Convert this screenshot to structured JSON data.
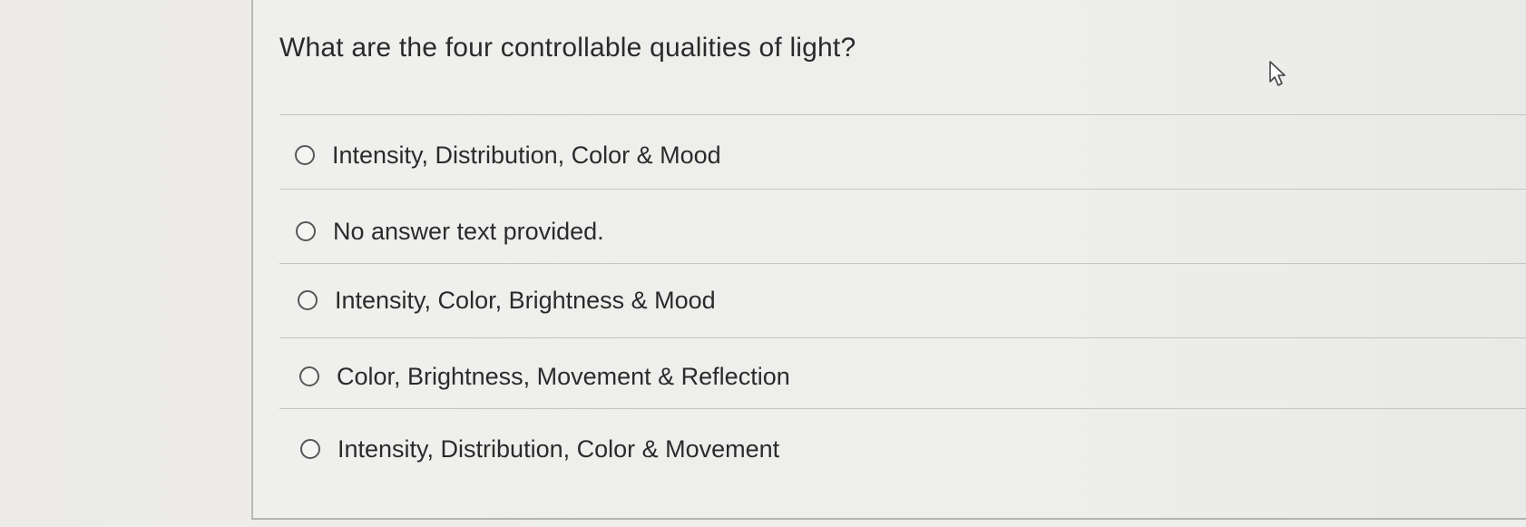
{
  "question": {
    "text": "What are the four controllable qualities of light?"
  },
  "options": [
    {
      "label": "Intensity, Distribution, Color & Mood"
    },
    {
      "label": "No answer text provided."
    },
    {
      "label": "Intensity, Color, Brightness & Mood"
    },
    {
      "label": "Color, Brightness, Movement & Reflection"
    },
    {
      "label": "Intensity, Distribution, Color & Movement"
    }
  ],
  "icons": {
    "cursor": "mouse-pointer-icon",
    "radio": "radio-button-unselected"
  },
  "colors": {
    "background": "#eeeeec",
    "text": "#2b2b2b",
    "divider": "#c5c5c3",
    "radio_border": "#575757"
  }
}
